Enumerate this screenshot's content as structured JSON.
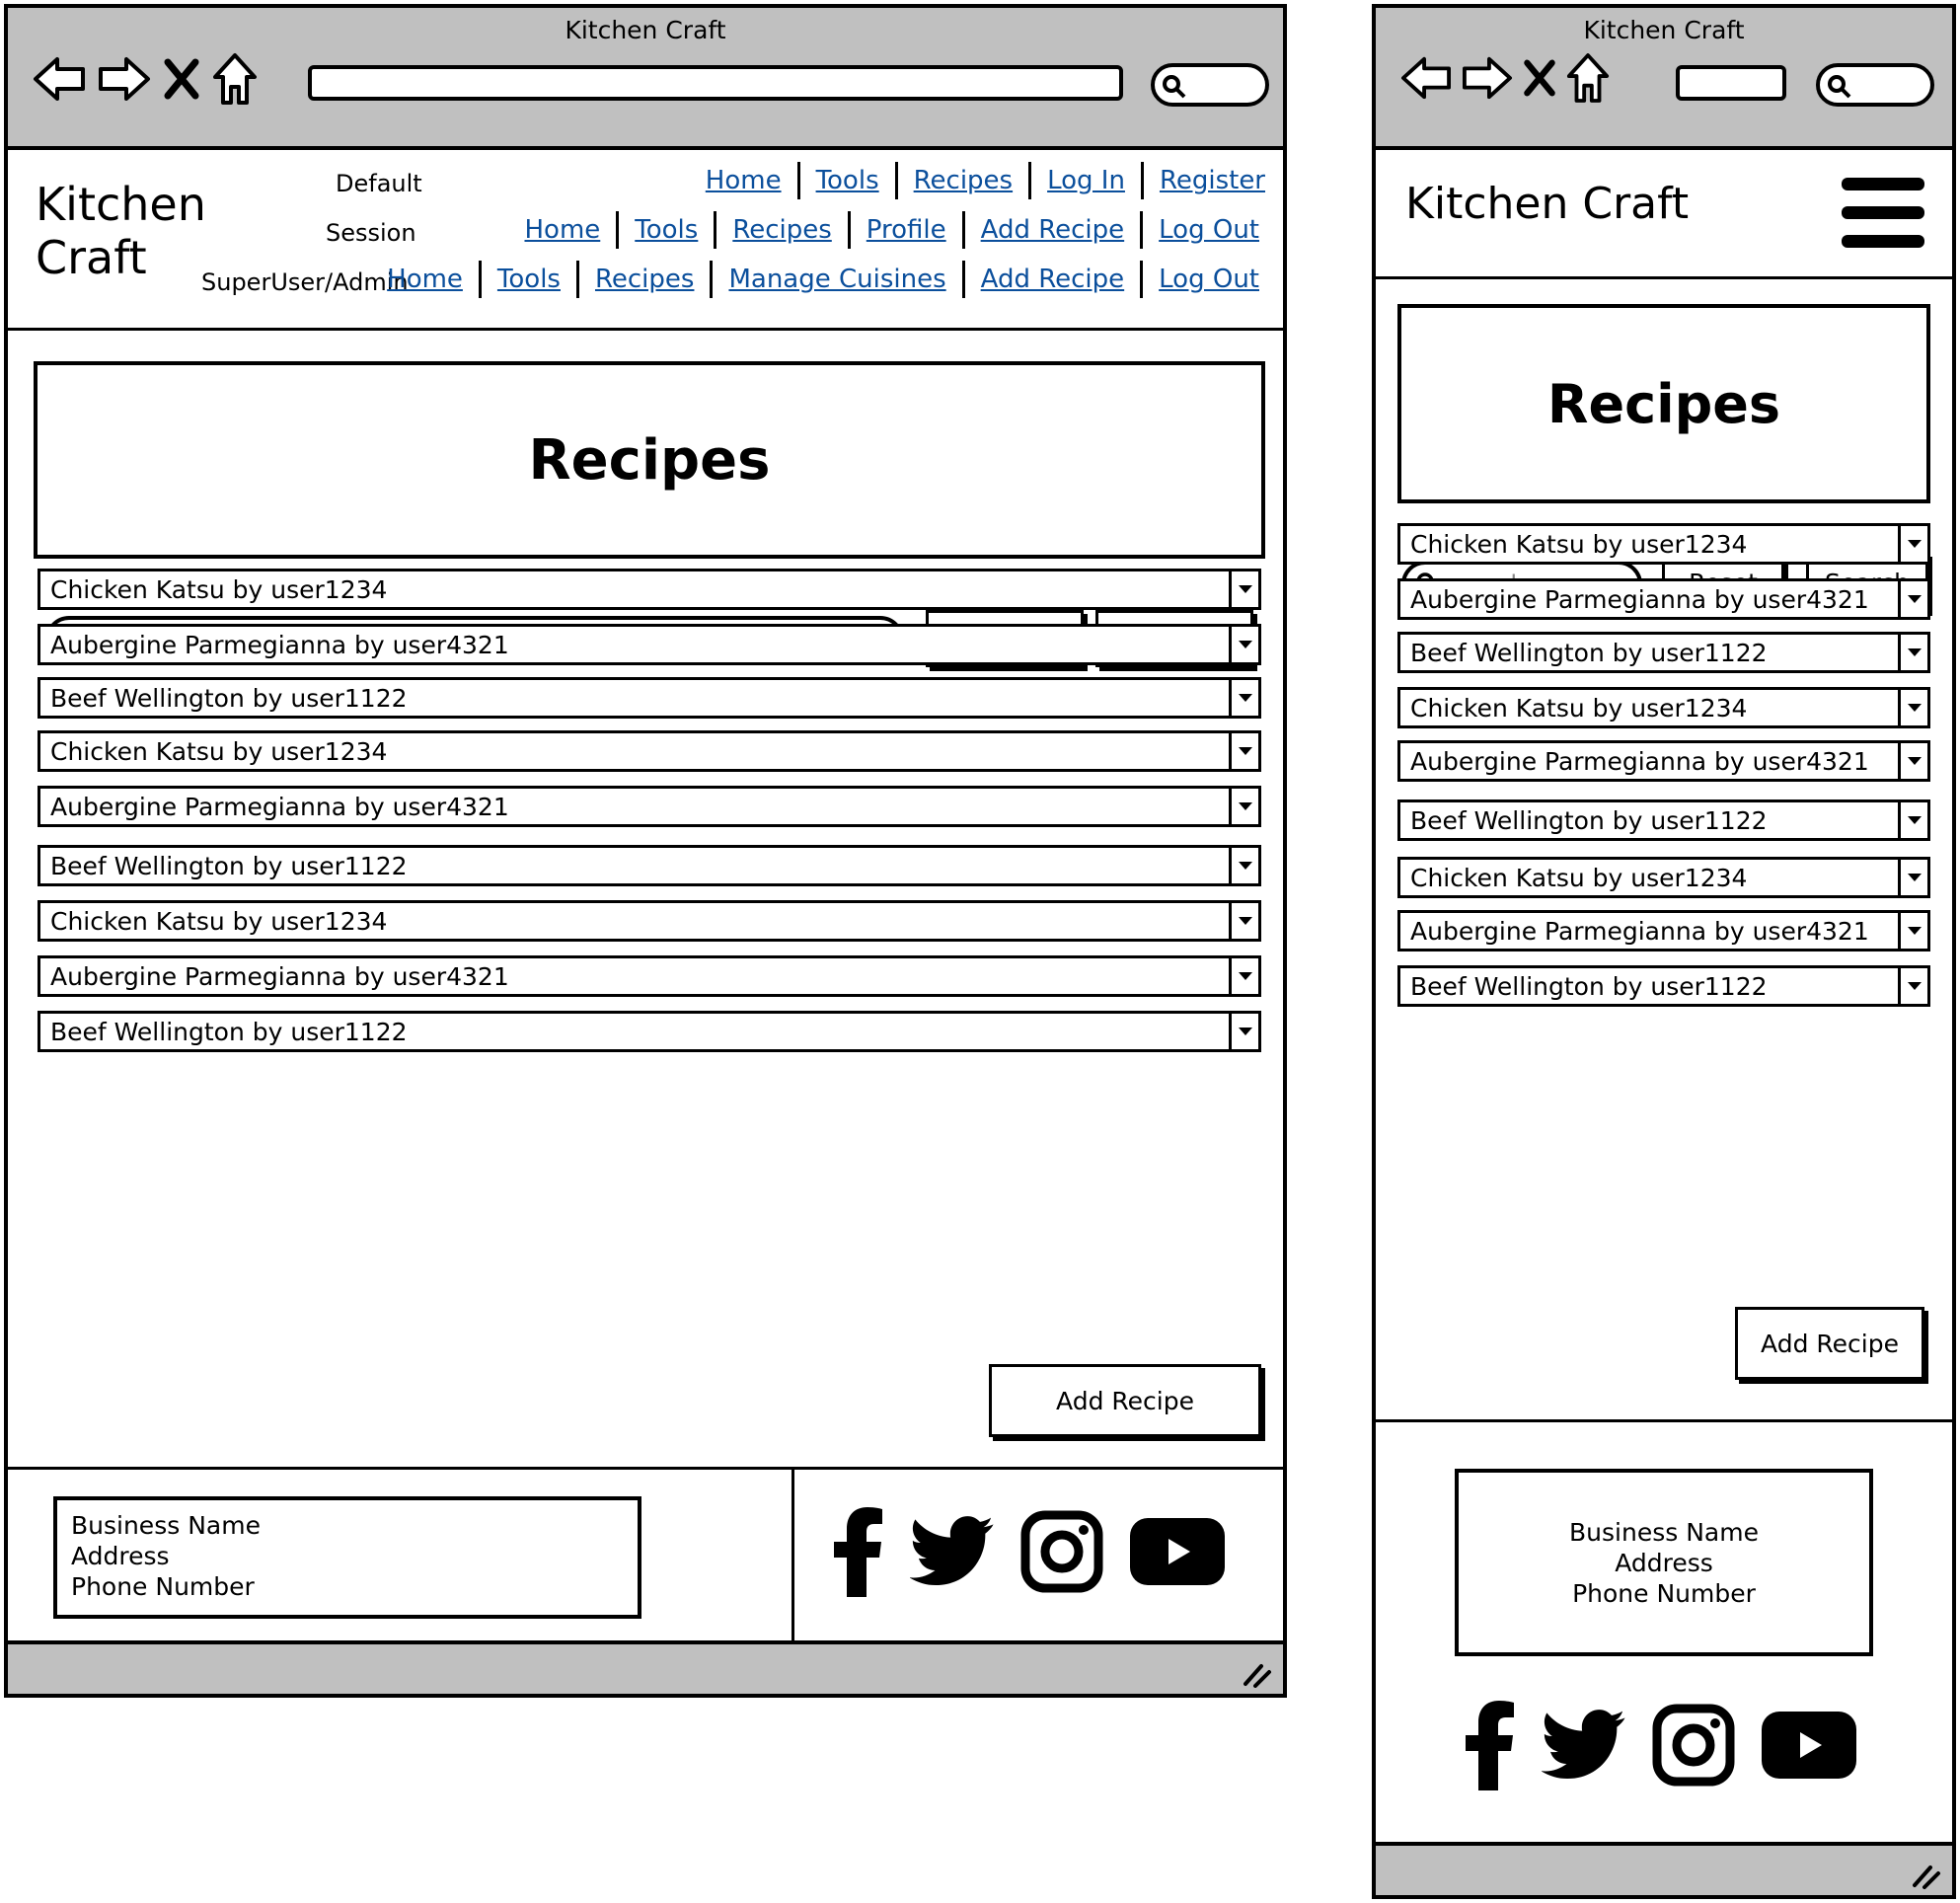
{
  "window_title": "Kitchen Craft",
  "brand": "Kitchen Craft",
  "brand_line1": "Kitchen",
  "brand_line2": "Craft",
  "nav": {
    "default": {
      "label": "Default",
      "links": [
        "Home",
        "Tools",
        "Recipes",
        "Log In",
        "Register"
      ]
    },
    "session": {
      "label": "Session",
      "links": [
        "Home",
        "Tools",
        "Recipes",
        "Profile",
        "Add Recipe",
        "Log Out"
      ]
    },
    "admin": {
      "label": "SuperUser/Admin",
      "links": [
        "Home",
        "Tools",
        "Recipes",
        "Manage Cuisines",
        "Add Recipe",
        "Log Out"
      ]
    }
  },
  "page_title": "Recipes",
  "search": {
    "placeholder": "search",
    "reset_label": "Reset",
    "search_label": "Search"
  },
  "recipes": [
    "Chicken Katsu by user1234",
    "Aubergine Parmegianna by user4321",
    "Beef Wellington by user1122",
    "Chicken Katsu by user1234",
    "Aubergine Parmegianna by user4321",
    "Beef Wellington by user1122",
    "Chicken Katsu by user1234",
    "Aubergine Parmegianna by user4321",
    "Beef Wellington by user1122"
  ],
  "add_recipe_label": "Add Recipe",
  "footer": {
    "business_name": "Business Name",
    "address": "Address",
    "phone": "Phone Number",
    "social_icons": [
      "facebook-icon",
      "twitter-icon",
      "instagram-icon",
      "youtube-icon"
    ]
  },
  "colors": {
    "chrome": "#c0c0c0",
    "link": "#0b4f9c",
    "border": "#000000"
  }
}
